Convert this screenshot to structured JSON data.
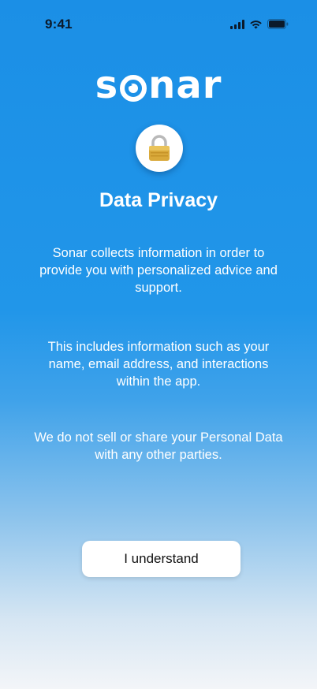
{
  "status_bar": {
    "time": "9:41"
  },
  "brand": {
    "logo_start": "s",
    "logo_end": "nar"
  },
  "content": {
    "title": "Data Privacy",
    "paragraphs": [
      "Sonar collects information in order to provide you with personalized advice and support.",
      "This includes information such as your name, email address, and interactions within the app.",
      "We do not sell or share your Personal Data with any other parties."
    ]
  },
  "actions": {
    "understand_label": "I understand"
  },
  "colors": {
    "background_top": "#1b8fe6",
    "background_bottom": "#f3f5f8",
    "button": "#ffffff"
  },
  "icons": {
    "center": "lock-icon"
  }
}
